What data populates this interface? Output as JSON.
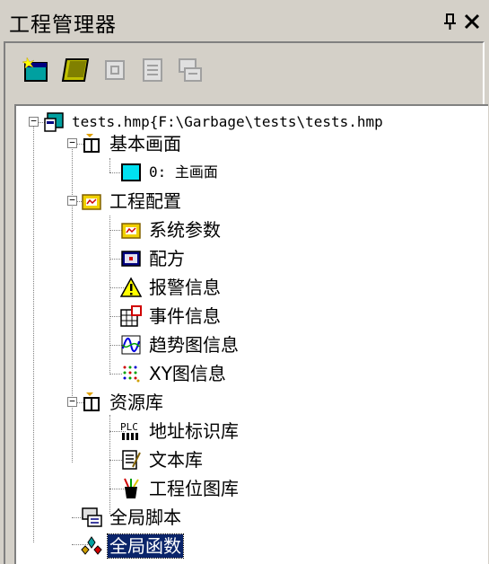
{
  "window": {
    "title": "工程管理器",
    "pin_glyph": "ᵖ",
    "close_glyph": "×"
  },
  "toolbar": {
    "buttons": [
      {
        "name": "new-window-icon",
        "enabled": true
      },
      {
        "name": "open-window-icon",
        "enabled": true
      },
      {
        "name": "import-icon",
        "enabled": false
      },
      {
        "name": "list-icon",
        "enabled": false
      },
      {
        "name": "script-icon",
        "enabled": false
      }
    ]
  },
  "tree": {
    "root": {
      "label": "tests.hmp{F:\\Garbage\\tests\\tests.hmp"
    },
    "basic_screens": {
      "label": "基本画面"
    },
    "main_screen": {
      "label": "0: 主画面"
    },
    "project_config": {
      "label": "工程配置"
    },
    "system_params": {
      "label": "系统参数"
    },
    "recipe": {
      "label": "配方"
    },
    "alarm_info": {
      "label": "报警信息"
    },
    "event_info": {
      "label": "事件信息"
    },
    "trend_info": {
      "label": "趋势图信息"
    },
    "xy_info": {
      "label": "XY图信息"
    },
    "resources": {
      "label": "资源库"
    },
    "address_lib": {
      "label": "地址标识库"
    },
    "text_lib": {
      "label": "文本库"
    },
    "bitmap_lib": {
      "label": "工程位图库"
    },
    "global_script": {
      "label": "全局脚本"
    },
    "global_func": {
      "label": "全局函数",
      "selected": true
    }
  },
  "colors": {
    "face": "#d4d0c8",
    "selection": "#0a246a",
    "tree_bg": "#ffffff"
  }
}
